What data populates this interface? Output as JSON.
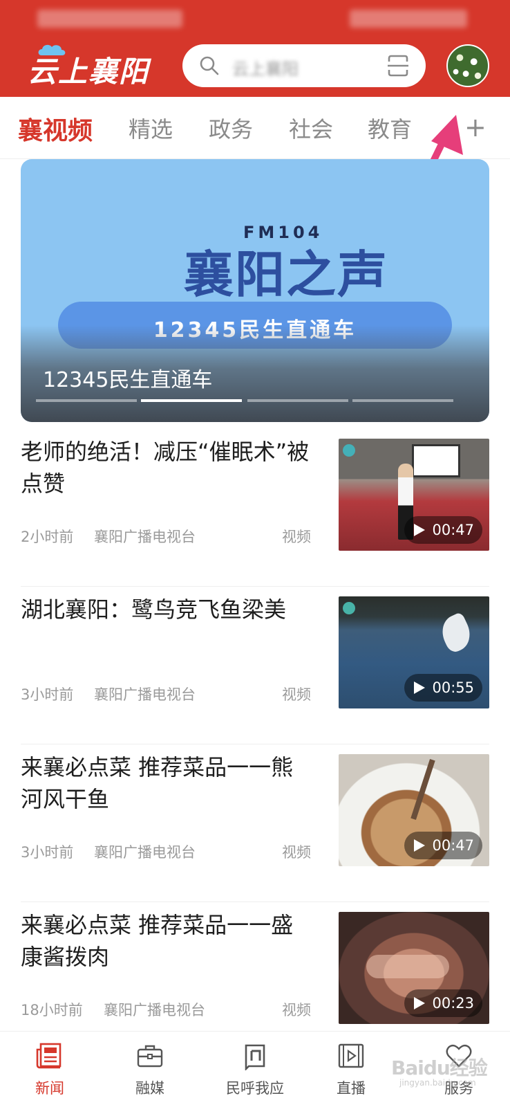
{
  "app": {
    "logo_text": "云上襄阳",
    "search_placeholder": "云上襄阳"
  },
  "tabs": [
    {
      "label": "襄视频",
      "active": true
    },
    {
      "label": "精选",
      "active": false
    },
    {
      "label": "政务",
      "active": false
    },
    {
      "label": "社会",
      "active": false
    },
    {
      "label": "教育",
      "active": false
    }
  ],
  "tab_add": "+",
  "banner": {
    "fm": "FM104",
    "title": "襄阳之声",
    "pill_text": "12345民生直通车",
    "caption": "12345民生直通车",
    "page_count": 4,
    "active_page": 2
  },
  "news": [
    {
      "title": "老师的绝活！减压“催眠术”被点赞",
      "time": "2小时前",
      "source": "襄阳广播电视台",
      "type": "视频",
      "duration": "00:47",
      "thumb": "classroom"
    },
    {
      "title": "湖北襄阳：鹭鸟竞飞鱼梁美",
      "time": "3小时前",
      "source": "襄阳广播电视台",
      "type": "视频",
      "duration": "00:55",
      "thumb": "lake-egret"
    },
    {
      "title": "来襄必点菜 推荐菜品一一熊河风干鱼",
      "time": "3小时前",
      "source": "襄阳广播电视台",
      "type": "视频",
      "duration": "00:47",
      "thumb": "dried-fish-dish"
    },
    {
      "title": "来襄必点菜 推荐菜品一一盛康酱拨肉",
      "time": "18小时前",
      "source": "襄阳广播电视台",
      "type": "视频",
      "duration": "00:23",
      "thumb": "braised-pork"
    }
  ],
  "bottom_nav": [
    {
      "label": "新闻",
      "icon": "news-icon",
      "active": true
    },
    {
      "label": "融媒",
      "icon": "briefcase-icon",
      "active": false
    },
    {
      "label": "民呼我应",
      "icon": "hotline-icon",
      "active": false
    },
    {
      "label": "直播",
      "icon": "live-film-icon",
      "active": false
    },
    {
      "label": "服务",
      "icon": "heart-icon",
      "active": false
    }
  ],
  "watermark": {
    "text": "Baidu经验",
    "url": "jingyan.baidu.com"
  },
  "colors": {
    "brand_red": "#d6372b",
    "annotation_arrow": "#e63e7a"
  }
}
